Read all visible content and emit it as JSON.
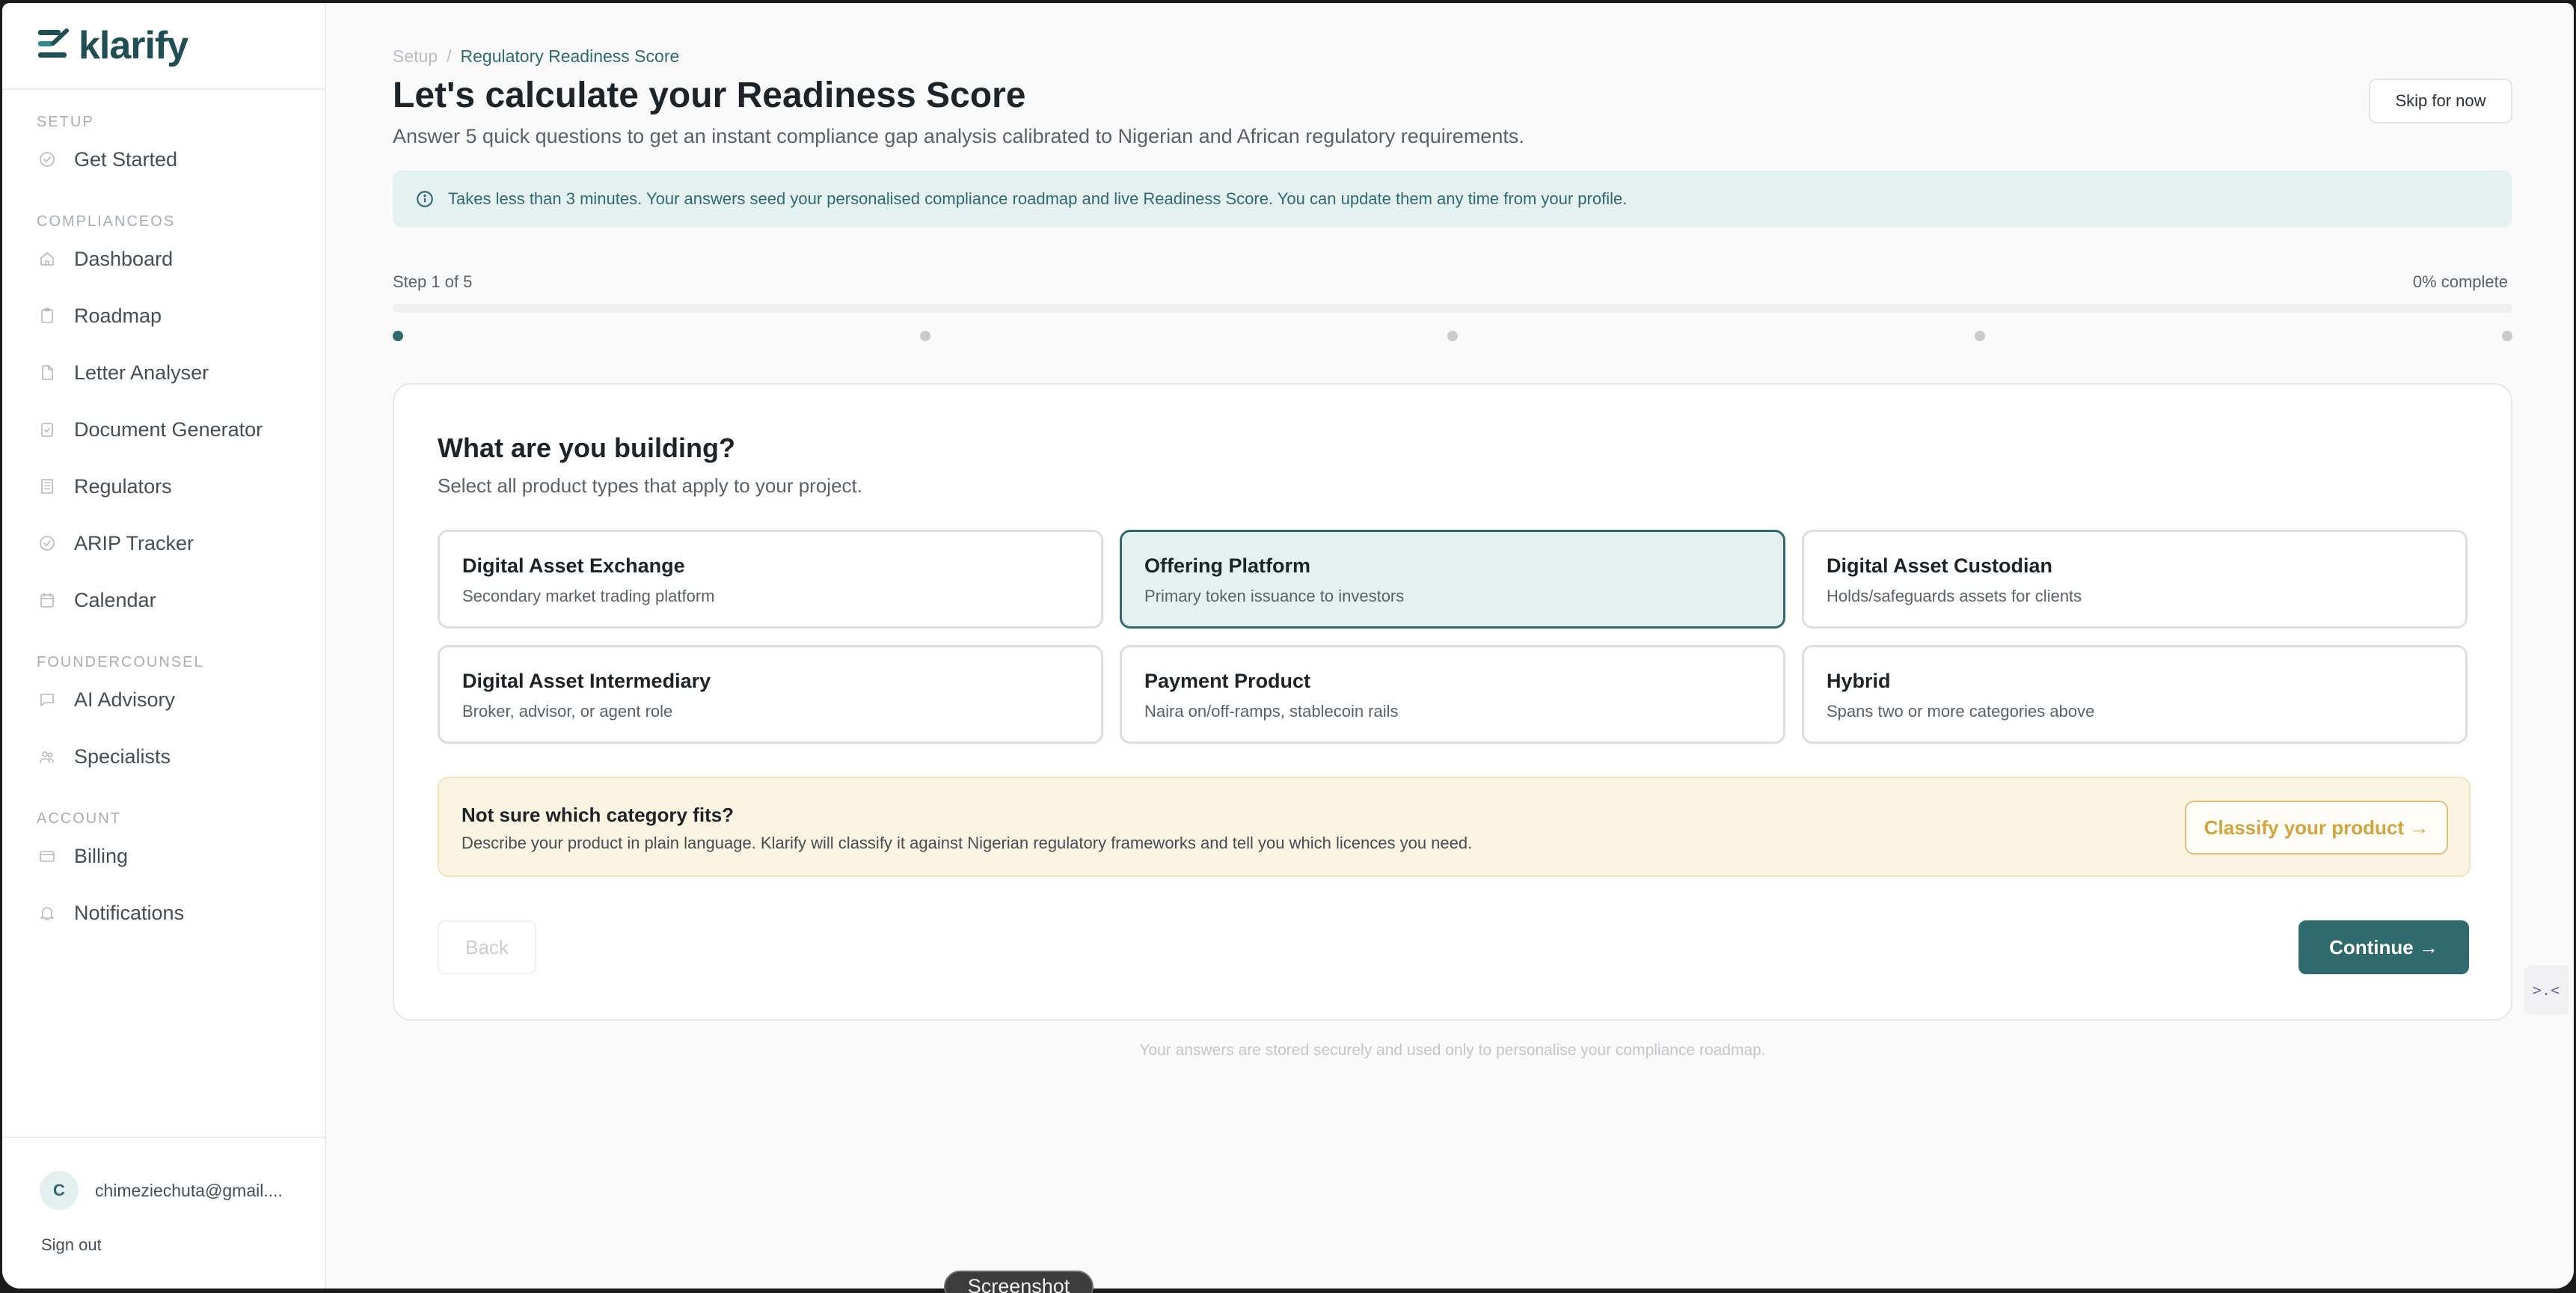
{
  "brand": {
    "name": "klarify",
    "color": "#1f4e55"
  },
  "sidebar": {
    "sections": [
      {
        "label": "SETUP",
        "items": [
          {
            "label": "Get Started",
            "icon": "check-circle-icon"
          }
        ]
      },
      {
        "label": "COMPLIANCEOS",
        "items": [
          {
            "label": "Dashboard",
            "icon": "home-icon"
          },
          {
            "label": "Roadmap",
            "icon": "clipboard-icon"
          },
          {
            "label": "Letter Analyser",
            "icon": "file-icon"
          },
          {
            "label": "Document Generator",
            "icon": "clipboard-check-icon"
          },
          {
            "label": "Regulators",
            "icon": "building-icon"
          },
          {
            "label": "ARIP Tracker",
            "icon": "check-circle-icon"
          },
          {
            "label": "Calendar",
            "icon": "calendar-icon"
          }
        ]
      },
      {
        "label": "FOUNDERCOUNSEL",
        "items": [
          {
            "label": "AI Advisory",
            "icon": "chat-icon"
          },
          {
            "label": "Specialists",
            "icon": "users-icon"
          }
        ]
      },
      {
        "label": "ACCOUNT",
        "items": [
          {
            "label": "Billing",
            "icon": "card-icon"
          },
          {
            "label": "Notifications",
            "icon": "bell-icon"
          }
        ]
      }
    ],
    "user": {
      "initial": "C",
      "email": "chimeziechuta@gmail...."
    },
    "sign_out": "Sign out"
  },
  "header": {
    "breadcrumb": {
      "parent": "Setup",
      "separator": "/",
      "current": "Regulatory Readiness Score"
    },
    "title": "Let's calculate your Readiness Score",
    "subtitle": "Answer 5 quick questions to get an instant compliance gap analysis calibrated to Nigerian and African regulatory requirements.",
    "skip_label": "Skip for now"
  },
  "info_banner": "Takes less than 3 minutes. Your answers seed your personalised compliance roadmap and live Readiness Score. You can update them any time from your profile.",
  "progress": {
    "step_label": "Step 1 of 5",
    "percent_label": "0% complete",
    "fraction_complete": 0,
    "current_step": 1,
    "total_steps": 5
  },
  "question": {
    "title": "What are you building?",
    "subtitle": "Select all product types that apply to your project.",
    "options": [
      {
        "title": "Digital Asset Exchange",
        "desc": "Secondary market trading platform",
        "selected": false
      },
      {
        "title": "Offering Platform",
        "desc": "Primary token issuance to investors",
        "selected": true
      },
      {
        "title": "Digital Asset Custodian",
        "desc": "Holds/safeguards assets for clients",
        "selected": false
      },
      {
        "title": "Digital Asset Intermediary",
        "desc": "Broker, advisor, or agent role",
        "selected": false
      },
      {
        "title": "Payment Product",
        "desc": "Naira on/off-ramps, stablecoin rails",
        "selected": false
      },
      {
        "title": "Hybrid",
        "desc": "Spans two or more categories above",
        "selected": false
      }
    ]
  },
  "classify": {
    "title": "Not sure which category fits?",
    "desc": "Describe your product in plain language. Klarify will classify it against Nigerian regulatory frameworks and tell you which licences you need.",
    "button": "Classify your product →"
  },
  "nav_buttons": {
    "back": "Back",
    "continue": "Continue →"
  },
  "footnote": "Your answers are stored securely and used only to personalise your compliance roadmap.",
  "widget": ">.<",
  "screenshot_pill": "Screenshot",
  "colors": {
    "accent": "#2f6b6e",
    "banner_bg": "#e5f1f1",
    "classify_bg": "#fbf4e3",
    "classify_accent": "#d3a43c"
  }
}
